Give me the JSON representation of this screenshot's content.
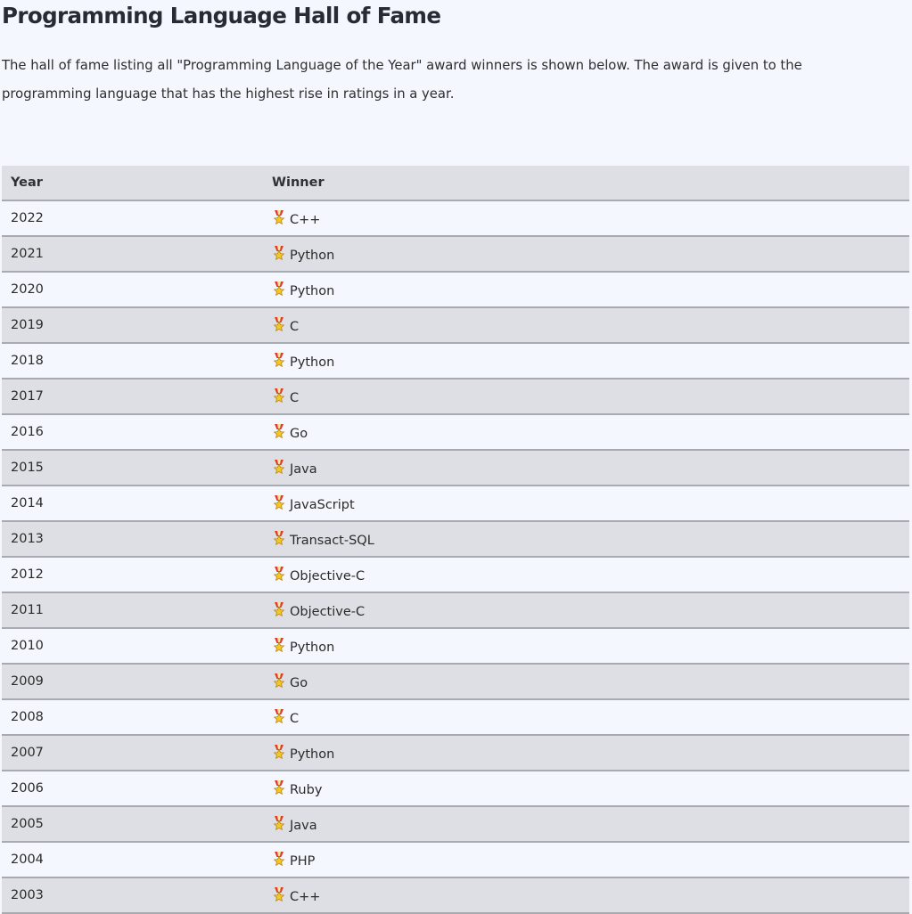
{
  "page": {
    "title": "Programming Language Hall of Fame",
    "intro": "The hall of fame listing all \"Programming Language of the Year\" award winners is shown below. The award is given to the programming language that has the highest rise in ratings in a year."
  },
  "table": {
    "headers": {
      "year": "Year",
      "winner": "Winner"
    },
    "rows": [
      {
        "year": "2022",
        "winner": "C++"
      },
      {
        "year": "2021",
        "winner": "Python"
      },
      {
        "year": "2020",
        "winner": "Python"
      },
      {
        "year": "2019",
        "winner": "C"
      },
      {
        "year": "2018",
        "winner": "Python"
      },
      {
        "year": "2017",
        "winner": "C"
      },
      {
        "year": "2016",
        "winner": "Go"
      },
      {
        "year": "2015",
        "winner": "Java"
      },
      {
        "year": "2014",
        "winner": "JavaScript"
      },
      {
        "year": "2013",
        "winner": "Transact-SQL"
      },
      {
        "year": "2012",
        "winner": "Objective-C"
      },
      {
        "year": "2011",
        "winner": "Objective-C"
      },
      {
        "year": "2010",
        "winner": "Python"
      },
      {
        "year": "2009",
        "winner": "Go"
      },
      {
        "year": "2008",
        "winner": "C"
      },
      {
        "year": "2007",
        "winner": "Python"
      },
      {
        "year": "2006",
        "winner": "Ruby"
      },
      {
        "year": "2005",
        "winner": "Java"
      },
      {
        "year": "2004",
        "winner": "PHP"
      },
      {
        "year": "2003",
        "winner": "C++"
      }
    ],
    "winner_icon": "award-medal-icon"
  },
  "colors": {
    "background": "#f4f7fd",
    "row_alt": "#dddfe4",
    "border": "#a8aab0",
    "medal_ribbon": "#e23a2e",
    "medal_star": "#f3c623"
  }
}
